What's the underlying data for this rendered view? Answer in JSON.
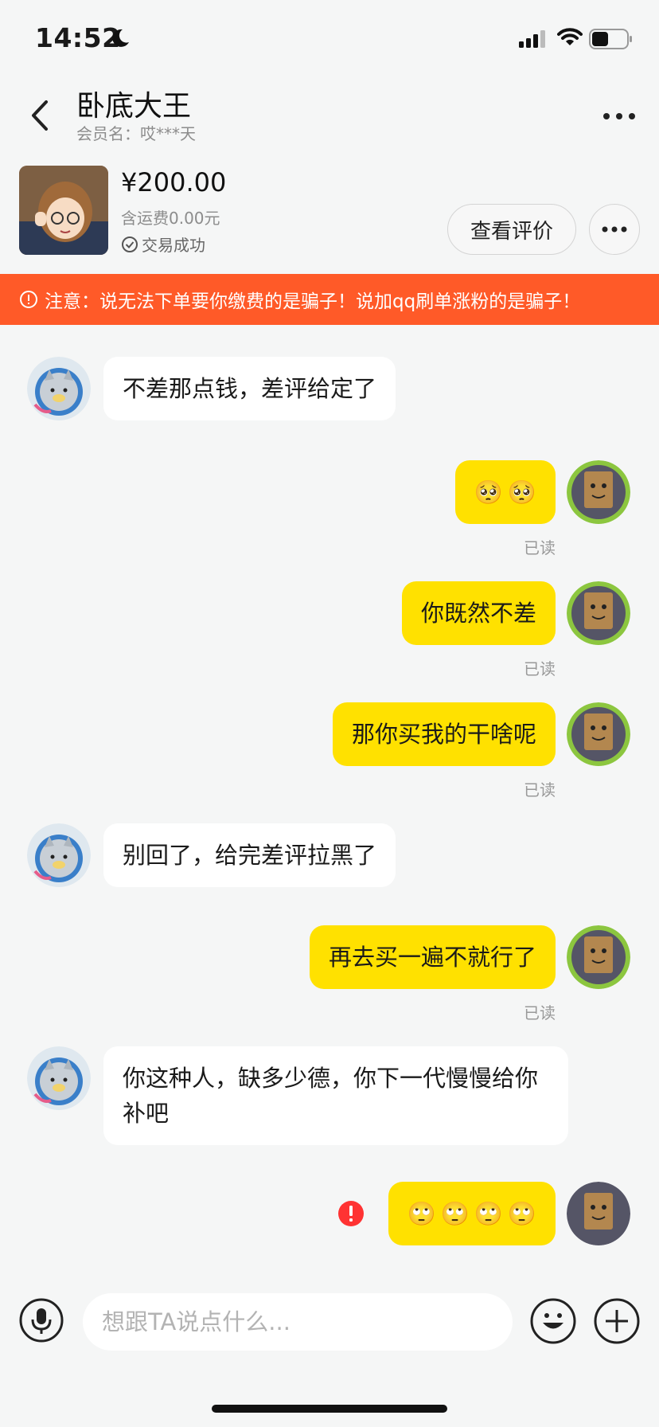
{
  "status_bar": {
    "time": "14:52"
  },
  "nav": {
    "title": "卧底大王",
    "subtitle": "会员名：哎***天"
  },
  "product": {
    "price": "¥200.00",
    "shipping": "含运费0.00元",
    "status": "交易成功",
    "review_button": "查看评价"
  },
  "warning": {
    "text": "注意：说无法下单要你缴费的是骗子！说加qq刷单涨粉的是骗子！"
  },
  "messages": [
    {
      "side": "left",
      "text": "不差那点钱，差评给定了"
    },
    {
      "side": "right",
      "emojis": [
        "🥺",
        "🥺"
      ],
      "read": "已读"
    },
    {
      "side": "right",
      "text": "你既然不差",
      "read": "已读"
    },
    {
      "side": "right",
      "text": "那你买我的干啥呢",
      "read": "已读"
    },
    {
      "side": "left",
      "text": "别回了，给完差评拉黑了"
    },
    {
      "side": "right",
      "text": "再去买一遍不就行了",
      "read": "已读"
    },
    {
      "side": "left",
      "text": "你这种人，缺多少德，你下一代慢慢给你补吧"
    },
    {
      "side": "right",
      "emojis": [
        "🙄",
        "🙄",
        "🙄",
        "🙄"
      ],
      "failed": true
    }
  ],
  "input": {
    "placeholder": "想跟TA说点什么..."
  },
  "colors": {
    "accent_yellow": "#ffe100",
    "warning_orange": "#ff5a28",
    "background": "#f5f6f6"
  },
  "icons": [
    "back-arrow-icon",
    "more-icon",
    "mic-icon",
    "emoji-icon",
    "plus-icon",
    "error-icon",
    "check-circle-icon"
  ]
}
